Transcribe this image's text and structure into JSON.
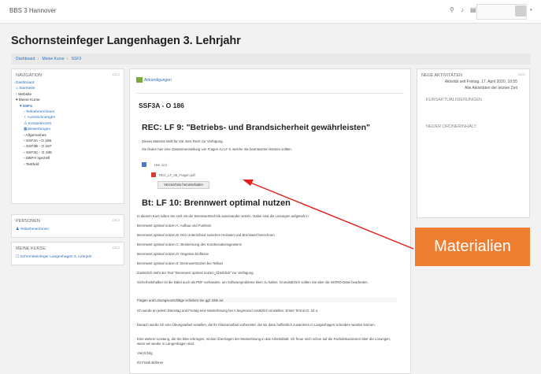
{
  "topbar": {
    "site_name": "BBS 3 Hannover",
    "icons": [
      "search-icon",
      "bell-icon",
      "message-icon",
      "user-avatar-icon",
      "chevron-down-icon"
    ]
  },
  "course_title": "Schornsteinfeger Langenhagen 3. Lehrjahr",
  "breadcrumb": [
    "Dashboard",
    "Meine Kurse",
    "SSF3"
  ],
  "navigation": {
    "heading": "NAVIGATION",
    "items": [
      "Dashboard",
      "Startseite",
      "Website",
      "Meine Kurse",
      "SSF3",
      "Teilnehmer/innen",
      "Auszeichnungen",
      "Kompetenzen",
      "Bewertungen",
      "Allgemeines",
      "SSF3A - O 186",
      "SSF3B - O 187",
      "SSF3C - O 188",
      "DBFH speziell",
      "Testfeld"
    ]
  },
  "persons": {
    "heading": "PERSONEN",
    "link": "Teilnehmer/innen"
  },
  "my_courses": {
    "heading": "MEINE KURSE",
    "link": "Schornsteinfeger Langenhagen 3. Lehrjahr"
  },
  "main": {
    "announcements": "Ankündigungen",
    "section_title": "SSF3A - O 186",
    "rec_heading": "REC: LF 9: \"Betriebs- und Brandsicherheit gewährleisten\"",
    "rec_lines": [
      "Dieses Material stellt für Sie Jens Reck zur Verfügung.",
      "Sie finden hier eine Zusammenstellung von Fragen zu LF 9, welche Sie beantworten können sollten."
    ],
    "file_rows": [
      "Hier 11 k",
      "REC_LF_09_Fragen.pdf"
    ],
    "download_button": "Verzeichnis herunterladen",
    "bt_heading": "Bt: LF 10: Brennwert optimal nutzen",
    "bt_lines": [
      "In diesem Kurs sollen Sie sich mit der Brennwerttechnik auseinander setzen. Dabei sind die Lösungen aufgeteilt in:",
      "Brennwert optimal nutzen A: Aufbau und Funktion",
      "Brennwert optimal nutzen B: Den Unterschied zwischen Heizwert und Brennwert berechnen",
      "Brennwert optimal nutzen C: Bestimmung des Kondensationsgewinns",
      "Brennwert optimal nutzen D: Negative Einflüsse",
      "Brennwert optimal nutzen E: Brennwertnutzen bei Teillast",
      "Zusätzlich steht der Text \"Brennwert optimal nutzen_Überblick\" zur Verfügung.",
      "Sicherheitshalber ist die Datei auch als PDF vorhanden, um Softwareprobleme klein zu halten. Grundsätzlich sollten Sie aber die WORD-Datei bearbeiten.",
      "Fragen und Lösungsvorschläge schicken Sie ggf. bitte an:",
      "Ich werde an jedem Dienstag und Freitag eine Musterlösung bei A beginnend zusätzlich einstellen. Erster Termin D. 22.4.",
      "Danach werde ich eine Übungsarbeit erstellen, die ihr Klassenarbeit vorbereitet, die wir dann hoffentlich zusammen in Langenhagen schreiben werden können.",
      "Eine weitere Leistung, die Sie bitte erbringen, ist das Übertragen der Musterlösung in das Arbeitsblatt. Ich freue mich schon auf die Fachdiskussionen über die Lösungen, wenn wir wieder in Langenhagen sind.",
      "Viel Erfolg",
      "Ihr Frank Böhmer"
    ]
  },
  "recent_activity": {
    "heading": "NEUE AKTIVITÄTEN",
    "since": "Aktivität seit Freitag, 17. April 2020, 10:55",
    "link": "Alle Aktivitäten der letzten Zeit",
    "updates": "KURSAKTUALISIERUNGEN"
  },
  "new_content": "NEUER ORDNERINHALT:",
  "callout": "Materialien",
  "colors": {
    "accent": "#2a6ebb",
    "callout_bg": "#ed7d31",
    "arrow": "#e0201b"
  }
}
